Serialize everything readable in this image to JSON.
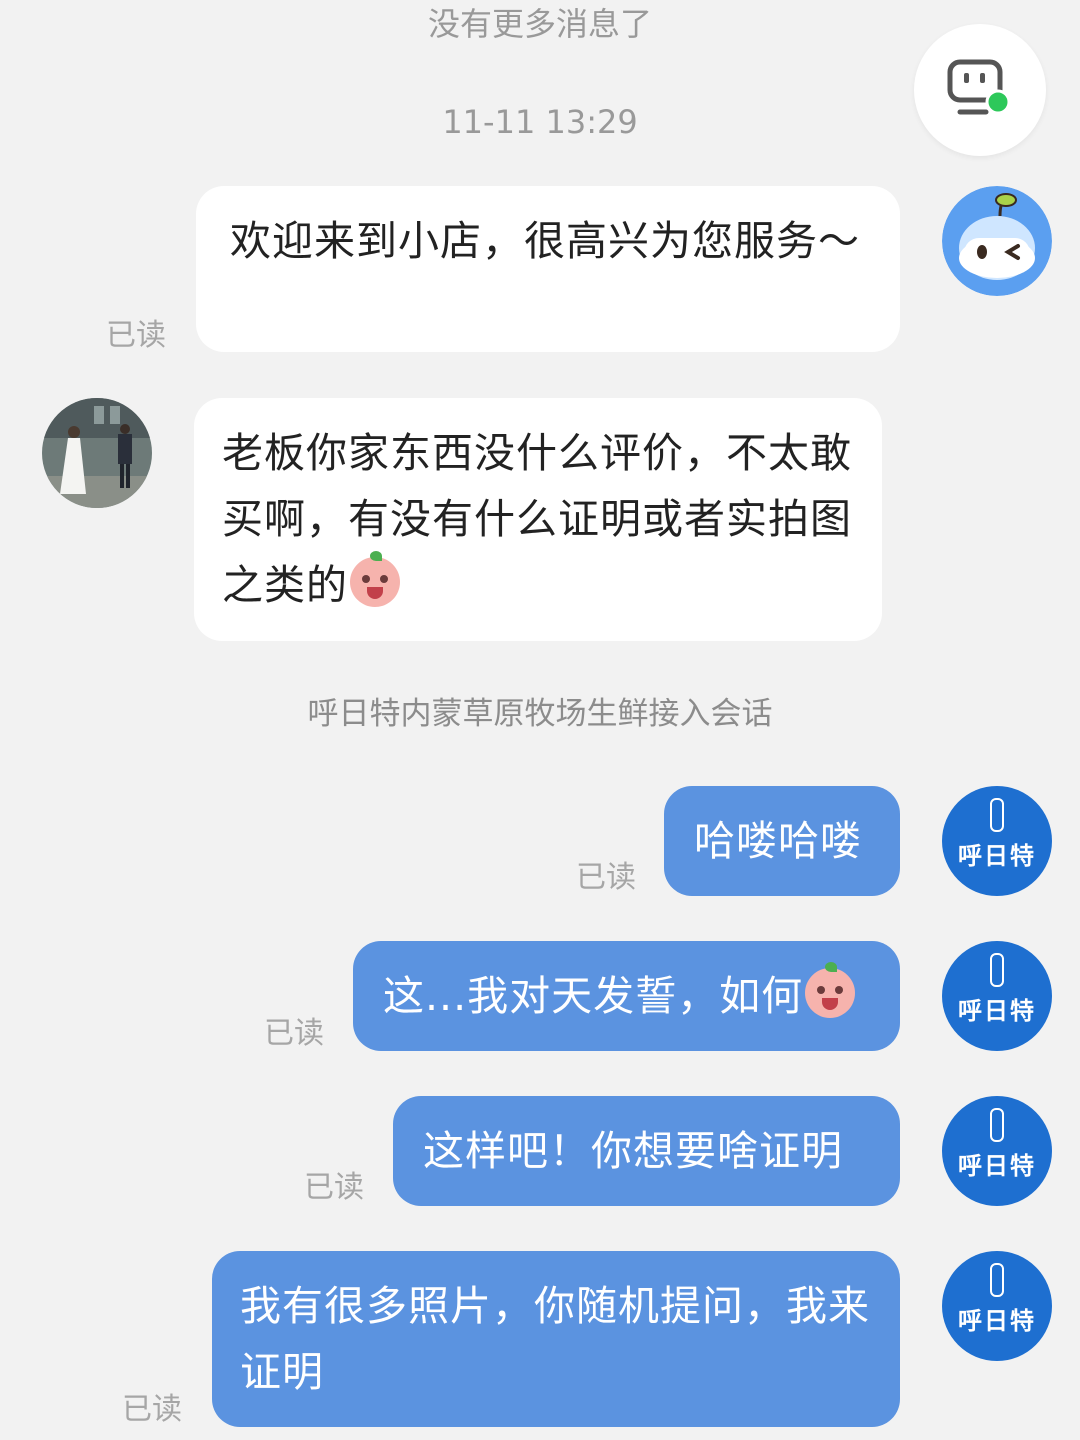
{
  "header": {
    "no_more": "没有更多消息了",
    "timestamp": "11-11 13:29"
  },
  "messages": [
    {
      "text": "欢迎来到小店，很高兴为您服务～",
      "status": "已读"
    },
    {
      "text": "老板你家东西没什么评价，不太敢买啊，有没有什么证明或者实拍图之类的",
      "emoji": "crying-face-emoji"
    },
    {
      "text": "哈喽哈喽",
      "status": "已读"
    },
    {
      "text": "这...我对天发誓，如何",
      "emoji": "crying-face-emoji",
      "status": "已读"
    },
    {
      "text": "这样吧！你想要啥证明",
      "status": "已读"
    },
    {
      "text": "我有很多照片，你随机提问，我来证明",
      "status": "已读"
    }
  ],
  "system_notice": "呼日特内蒙草原牧场生鲜接入会话",
  "shop_avatar_name": "呼日特",
  "icons": {
    "float_button": "customer-service-online-icon",
    "bot_avatar": "robot-avatar-icon"
  },
  "colors": {
    "background": "#f2f2f2",
    "outgoing_bubble": "#5b93e0",
    "incoming_bubble": "#ffffff",
    "shop_avatar": "#1e6fd0",
    "online_dot": "#2dc85a"
  }
}
